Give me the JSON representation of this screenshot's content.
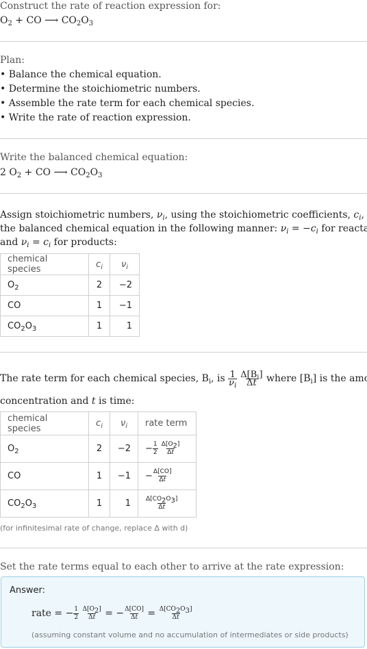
{
  "intro": {
    "title": "Construct the rate of reaction expression for:",
    "equation": {
      "reactants": [
        {
          "formula": "O2"
        },
        {
          "formula": "CO"
        }
      ],
      "arrow": "⟶",
      "products": [
        {
          "formula": "CO2O3"
        }
      ]
    }
  },
  "plan": {
    "heading": "Plan:",
    "steps": [
      "• Balance the chemical equation.",
      "• Determine the stoichiometric numbers.",
      "• Assemble the rate term for each chemical species.",
      "• Write the rate of reaction expression."
    ]
  },
  "balanced": {
    "heading": "Write the balanced chemical equation:",
    "equation_text": "2 O2 + CO ⟶ CO2O3"
  },
  "stoich": {
    "text_line1": "Assign stoichiometric numbers, νi, using the stoichiometric coefficients, ci, from",
    "text_line2": "the balanced chemical equation in the following manner: νi = −ci for reactants",
    "text_line3": "and νi = ci for products:",
    "table": {
      "headers": [
        "chemical species",
        "ci",
        "νi"
      ],
      "rows": [
        {
          "species": "O2",
          "c": "2",
          "nu": "−2"
        },
        {
          "species": "CO",
          "c": "1",
          "nu": "−1"
        },
        {
          "species": "CO2O3",
          "c": "1",
          "nu": "1"
        }
      ]
    }
  },
  "rate_terms": {
    "text_before": "The rate term for each chemical species, Bi, is",
    "text_after": "where [Bi] is the amount",
    "text_line2": "concentration and t is time:",
    "table": {
      "headers": [
        "chemical species",
        "ci",
        "νi",
        "rate term"
      ],
      "rows": [
        {
          "species": "O2",
          "c": "2",
          "nu": "−2",
          "term": "−1/2 Δ[O2]/Δt"
        },
        {
          "species": "CO",
          "c": "1",
          "nu": "−1",
          "term": "−Δ[CO]/Δt"
        },
        {
          "species": "CO2O3",
          "c": "1",
          "nu": "1",
          "term": "Δ[CO2O3]/Δt"
        }
      ]
    },
    "note": "(for infinitesimal rate of change, replace Δ with d)"
  },
  "final": {
    "heading": "Set the rate terms equal to each other to arrive at the rate expression:",
    "answer_label": "Answer:",
    "rate_label": "rate",
    "expression": "rate = −1/2 Δ[O2]/Δt = −Δ[CO]/Δt = Δ[CO2O3]/Δt",
    "assumption": "(assuming constant volume and no accumulation of intermediates or side products)"
  },
  "colors": {
    "answer_bg": "#eef7fb",
    "answer_border": "#9dcde6",
    "divider": "#cfcfcf"
  }
}
